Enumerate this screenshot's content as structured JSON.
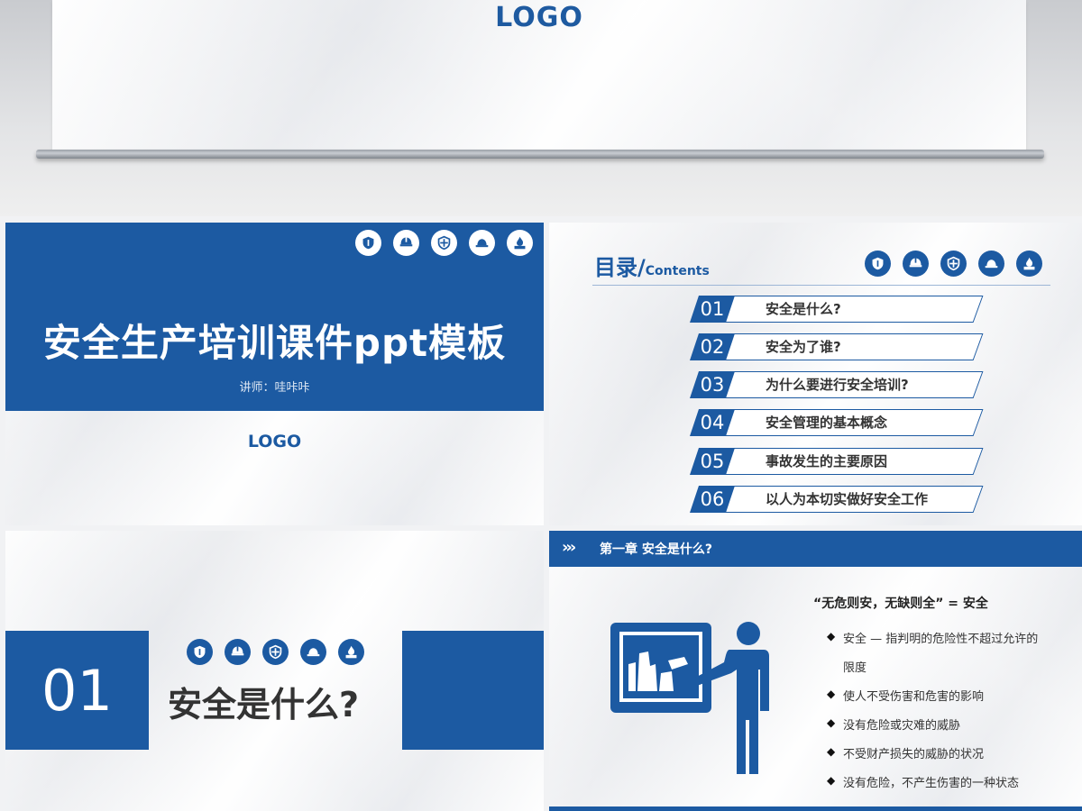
{
  "top": {
    "logo": "LOGO"
  },
  "slide1": {
    "title": "安全生产培训课件ppt模板",
    "lecturer": "讲师：哇咔咔",
    "logo": "LOGO",
    "icons": [
      "shield-icon",
      "helmet-icon",
      "cross-shield-icon",
      "hardhat-icon",
      "fire-icon"
    ]
  },
  "slide2": {
    "title": "目录/",
    "subtitle": "Contents",
    "items": [
      {
        "num": "01",
        "label": "安全是什么?"
      },
      {
        "num": "02",
        "label": "安全为了谁?"
      },
      {
        "num": "03",
        "label": "为什么要进行安全培训?"
      },
      {
        "num": "04",
        "label": "安全管理的基本概念"
      },
      {
        "num": "05",
        "label": "事故发生的主要原因"
      },
      {
        "num": "06",
        "label": "以人为本切实做好安全工作"
      }
    ]
  },
  "slide3": {
    "number": "01",
    "heading": "安全是什么?"
  },
  "slide4": {
    "chevrons": "›››",
    "chapter": "第一章  安全是什么?",
    "quote": "“无危则安，无缺则全” =  安全",
    "bullets": [
      "安全 — 指判明的危险性不超过允许的",
      "限度",
      "使人不受伤害和危害的影响",
      "没有危险或灾难的威胁",
      "不受财产损失的威胁的状况",
      "没有危险，不产生伤害的一种状态"
    ]
  },
  "colors": {
    "brand": "#1c5aa2",
    "text": "#333333"
  }
}
